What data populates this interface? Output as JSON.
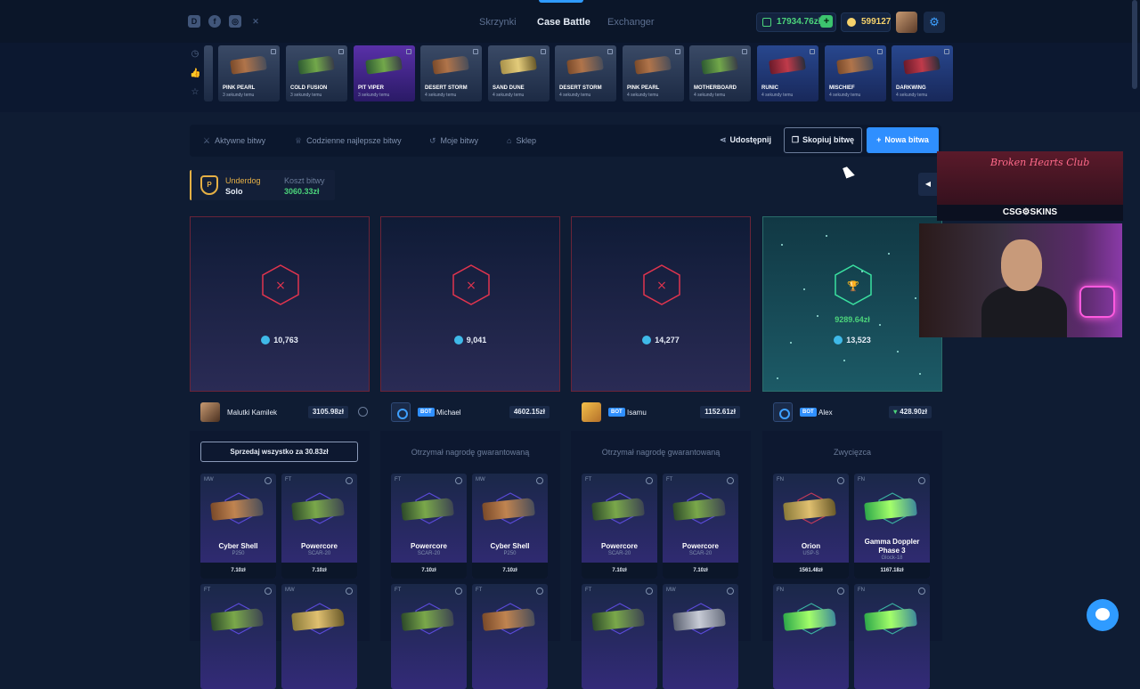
{
  "header": {
    "nav": [
      "Skrzynki",
      "Case Battle",
      "Exchanger"
    ],
    "active_nav": "Case Battle",
    "balance_money": "17934.76zł",
    "balance_coins": "599127",
    "social_icons": [
      "discord-icon",
      "facebook-icon",
      "instagram-icon",
      "x-icon"
    ]
  },
  "drops": [
    {
      "name": "PINK PEARL",
      "sub": "3 sekundy temu"
    },
    {
      "name": "COLD FUSION",
      "sub": "3 sekundy temu"
    },
    {
      "name": "PIT VIPER",
      "sub": "3 sekundy temu"
    },
    {
      "name": "DESERT STORM",
      "sub": "4 sekundy temu"
    },
    {
      "name": "SAND DUNE",
      "sub": "4 sekundy temu"
    },
    {
      "name": "DESERT STORM",
      "sub": "4 sekundy temu"
    },
    {
      "name": "PINK PEARL",
      "sub": "4 sekundy temu"
    },
    {
      "name": "MOTHERBOARD",
      "sub": "4 sekundy temu"
    },
    {
      "name": "RUNIC",
      "sub": "4 sekundy temu"
    },
    {
      "name": "MISCHIEF",
      "sub": "4 sekundy temu"
    },
    {
      "name": "DARKWING",
      "sub": "4 sekundy temu"
    }
  ],
  "tabs": {
    "active": "Aktywne bitwy",
    "daily": "Codzienne najlepsze bitwy",
    "mine": "Moje bitwy",
    "shop": "Sklep",
    "share": "Udostępnij",
    "copy": "Skopiuj bitwę",
    "new": "Nowa bitwa"
  },
  "battle_info": {
    "mode": "Underdog",
    "type": "Solo",
    "cost_label": "Koszt bitwy",
    "cost": "3060.33zł"
  },
  "stream": {
    "title": "Broken Hearts Club",
    "brand": "CSG⚙SKINS"
  },
  "columns": [
    {
      "arena_value": "10,763",
      "player": "Malutki Kamilek",
      "player_value": "3105.98zł",
      "sell_label": "Sprzedaj wszystko za 30.83zł",
      "items": [
        {
          "cond": "MW",
          "name": "Cyber Shell",
          "sub": "P250",
          "price": "7.10zł"
        },
        {
          "cond": "FT",
          "name": "Powercore",
          "sub": "SCAR-20",
          "price": "7.10zł"
        },
        {
          "cond": "FT",
          "name": "",
          "sub": "",
          "price": ""
        },
        {
          "cond": "MW",
          "name": "",
          "sub": "",
          "price": ""
        }
      ]
    },
    {
      "arena_value": "9,041",
      "bot": "BOT",
      "player": "Michael",
      "player_value": "4602.15zł",
      "message": "Otrzymał nagrodę gwarantowaną",
      "items": [
        {
          "cond": "FT",
          "name": "Powercore",
          "sub": "SCAR-20",
          "price": "7.10zł"
        },
        {
          "cond": "MW",
          "name": "Cyber Shell",
          "sub": "P250",
          "price": "7.10zł"
        },
        {
          "cond": "FT",
          "name": "",
          "sub": "",
          "price": ""
        },
        {
          "cond": "FT",
          "name": "",
          "sub": "",
          "price": ""
        }
      ]
    },
    {
      "arena_value": "14,277",
      "bot": "BOT",
      "player": "Isamu",
      "player_value": "1152.61zł",
      "message": "Otrzymał nagrodę gwarantowaną",
      "items": [
        {
          "cond": "FT",
          "name": "Powercore",
          "sub": "SCAR-20",
          "price": "7.10zł"
        },
        {
          "cond": "FT",
          "name": "Powercore",
          "sub": "SCAR-20",
          "price": "7.10zł"
        },
        {
          "cond": "FT",
          "name": "",
          "sub": "",
          "price": ""
        },
        {
          "cond": "MW",
          "name": "",
          "sub": "",
          "price": ""
        }
      ]
    },
    {
      "arena_value": "13,523",
      "win_amount": "9289.64zł",
      "bot": "BOT",
      "player": "Alex",
      "player_value": "428.90zł",
      "message": "Zwycięzca",
      "items": [
        {
          "cond": "FN",
          "name": "Orion",
          "sub": "USP-S",
          "price": "1561.48zł"
        },
        {
          "cond": "FN",
          "name": "Gamma Doppler Phase 3",
          "sub": "Glock-18",
          "price": "1167.18zł"
        },
        {
          "cond": "FN",
          "name": "",
          "sub": "",
          "price": ""
        },
        {
          "cond": "FN",
          "name": "",
          "sub": "",
          "price": ""
        }
      ]
    }
  ]
}
